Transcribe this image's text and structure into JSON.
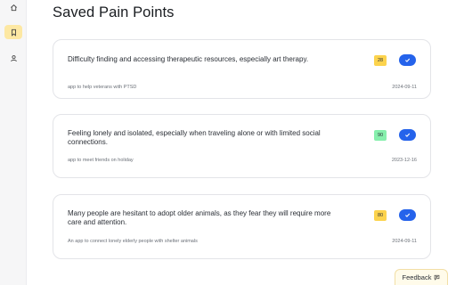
{
  "page": {
    "title": "Saved Pain Points"
  },
  "nav": [
    {
      "icon": "home-icon"
    },
    {
      "icon": "bookmark-icon"
    },
    {
      "icon": "user-icon"
    }
  ],
  "cards": [
    {
      "text": "Difficulty finding and accessing therapeutic resources, especially art therapy.",
      "source": "app to help veterans with PTSD",
      "date": "2024-09-11",
      "score": "28",
      "score_color": "#fcd34d"
    },
    {
      "text": "Feeling lonely and isolated, especially when traveling alone or with limited social connections.",
      "source": "app to meet friends on holiday",
      "date": "2023-12-16",
      "score": "90",
      "score_color": "#86efac"
    },
    {
      "text": "Many people are hesitant to adopt older animals, as they fear they will require more care and attention.",
      "source": "An app to connect lonely elderly people with shelter animals",
      "date": "2024-09-11",
      "score": "80",
      "score_color": "#fcd34d"
    }
  ],
  "feedback": {
    "label": "Feedback",
    "icon": "message-icon"
  },
  "colors": {
    "accent": "#2563eb",
    "active_nav": "#fde8a3"
  }
}
